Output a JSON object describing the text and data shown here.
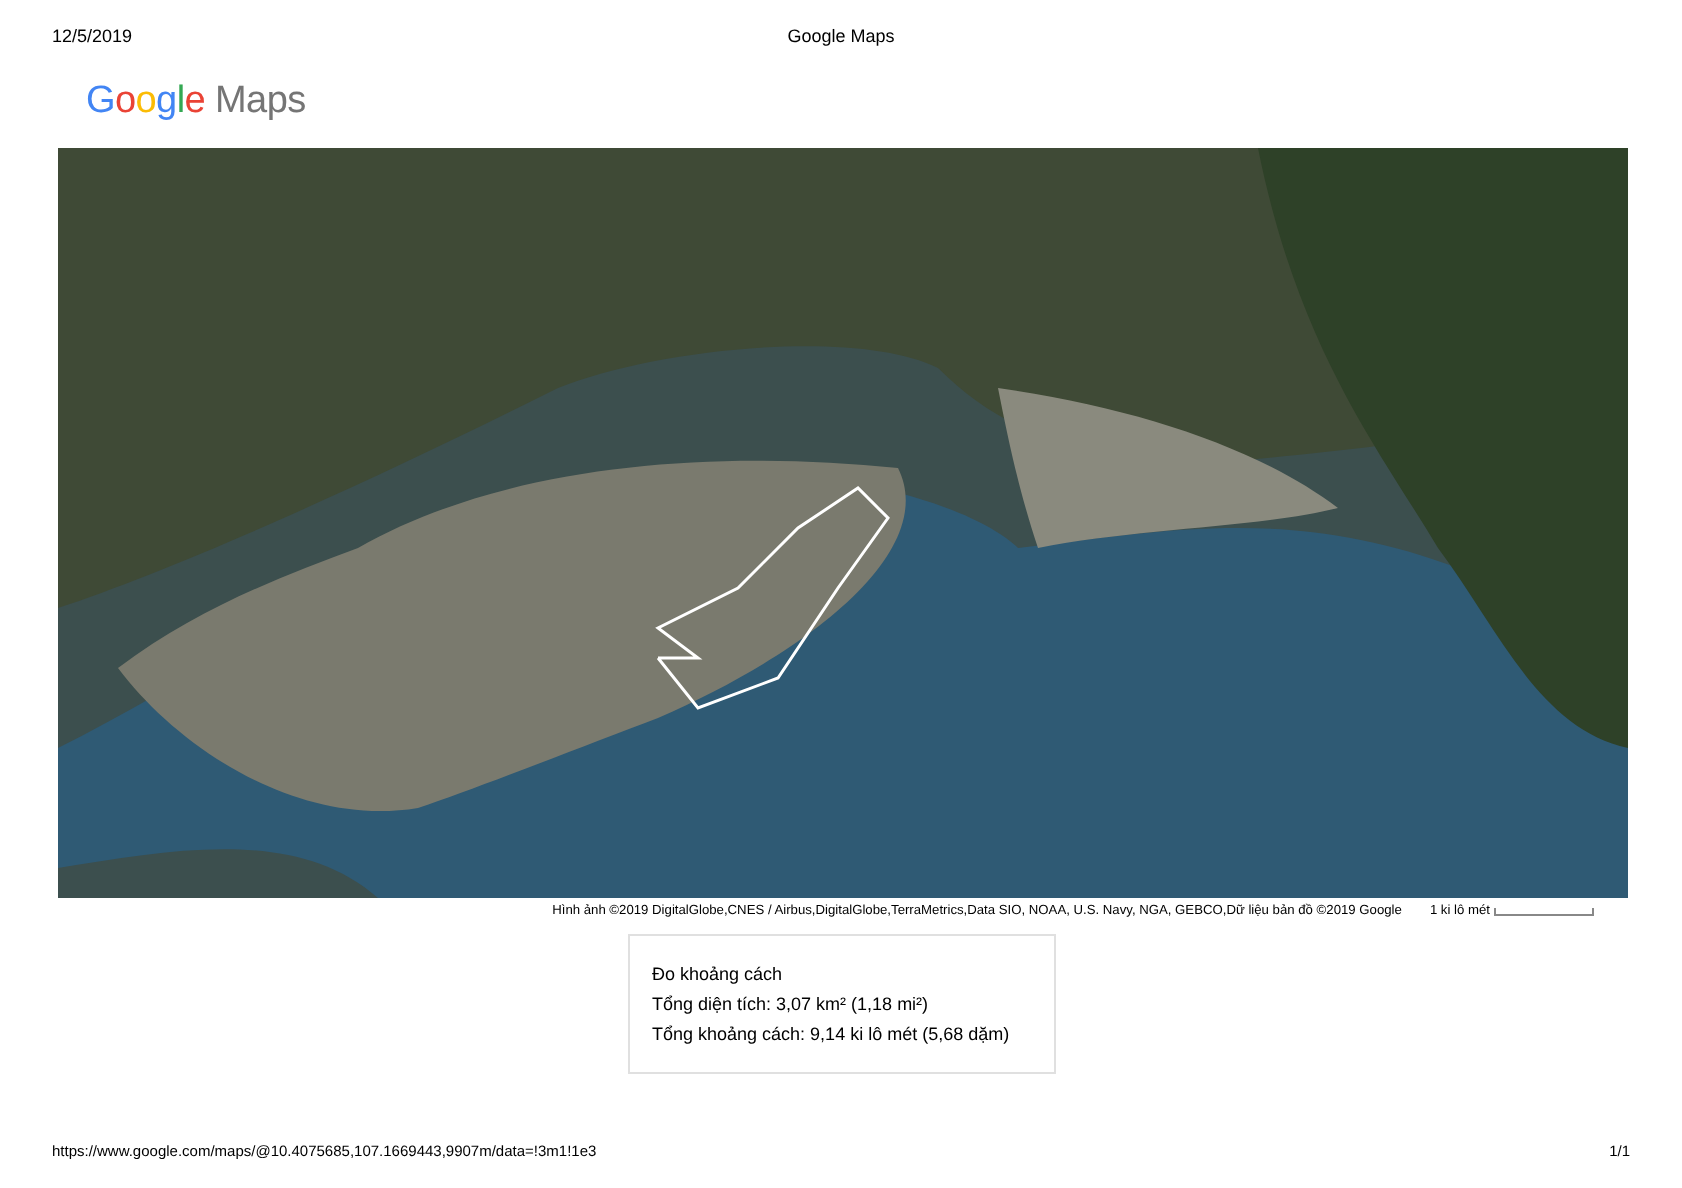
{
  "print_header": {
    "date": "12/5/2019",
    "title": "Google Maps"
  },
  "logo": {
    "brand": "Google",
    "product": "Maps"
  },
  "map": {
    "attribution": "Hình ảnh ©2019 DigitalGlobe,CNES / Airbus,DigitalGlobe,TerraMetrics,Data SIO, NOAA, U.S. Navy, NGA, GEBCO,Dữ liệu bản đồ ©2019 Google",
    "scale_label": "1 ki lô mét"
  },
  "measure_panel": {
    "title": "Đo khoảng cách",
    "lines": [
      "Tổng diện tích: 3,07 km² (1,18 mi²)",
      "Tổng khoảng cách: 9,14 ki lô mét (5,68 dặm)"
    ]
  },
  "print_footer": {
    "url": "https://www.google.com/maps/@10.4075685,107.1669443,9907m/data=!3m1!1e3",
    "page": "1/1"
  }
}
